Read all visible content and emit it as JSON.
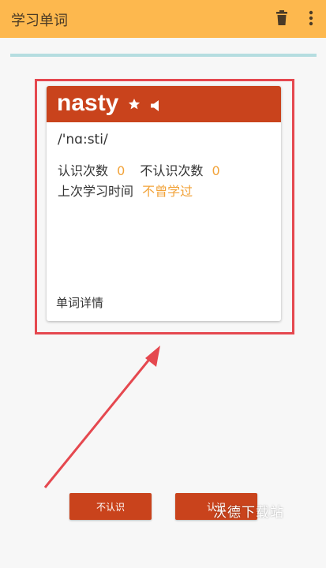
{
  "appbar": {
    "title": "学习单词",
    "delete_icon": "trash-icon",
    "menu_icon": "more-vertical-icon"
  },
  "card": {
    "word": "nasty",
    "star_icon": "star-icon",
    "speaker_icon": "speaker-icon",
    "phonetic": "/'nɑ:sti/",
    "known_label": "认识次数",
    "known_count": "0",
    "unknown_label": "不认识次数",
    "unknown_count": "0",
    "last_study_label": "上次学习时间",
    "last_study_value": "不曾学过",
    "detail_link": "单词详情"
  },
  "buttons": {
    "unknown": "不认识",
    "known": "认识"
  },
  "watermark": "沃德下载站",
  "colors": {
    "appbar": "#fdb84e",
    "card_header": "#c9431c",
    "accent": "#f2a33a",
    "annotation": "#e5484f"
  }
}
